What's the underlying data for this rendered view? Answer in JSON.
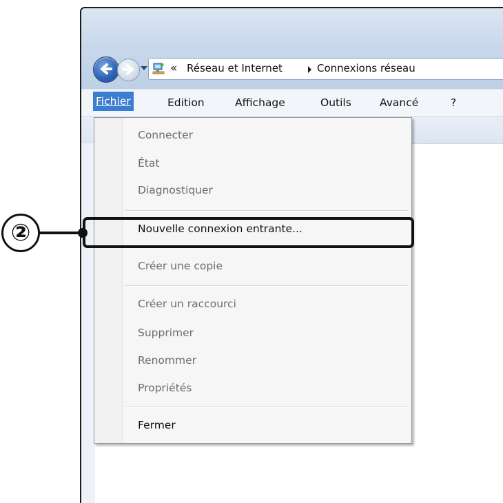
{
  "address": {
    "overflow_glyph": "«",
    "segment1": "Réseau et Internet",
    "segment2": "Connexions réseau"
  },
  "menubar": {
    "items": [
      "Fichier",
      "Edition",
      "Affichage",
      "Outils",
      "Avancé",
      "?"
    ]
  },
  "file_menu": {
    "connecter": "Connecter",
    "etat": "État",
    "diagnostiquer": "Diagnostiquer",
    "nouvelle_connexion": "Nouvelle connexion entrante...",
    "creer_copie": "Créer une copie",
    "creer_raccourci": "Créer un raccourci",
    "supprimer": "Supprimer",
    "renommer": "Renommer",
    "proprietes": "Propriétés",
    "fermer": "Fermer"
  },
  "annotation": {
    "step_number": "②"
  },
  "colors": {
    "menu_highlight": "#3b7ed0",
    "titlebar": "#c9d9ec",
    "callout": "#111111"
  }
}
